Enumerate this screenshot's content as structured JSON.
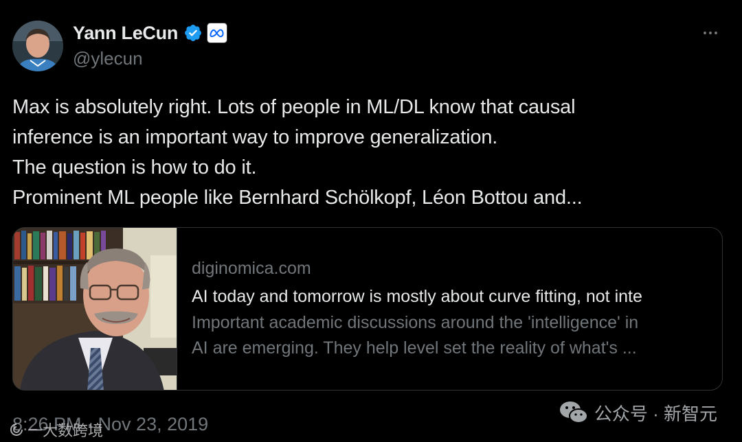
{
  "author": {
    "display_name": "Yann LeCun",
    "handle": "@ylecun",
    "verified_icon": "verified-badge-icon",
    "affiliation_icon": "meta-logo-icon",
    "avatar": "profile-photo"
  },
  "more_icon": "more-horizontal-icon",
  "tweet": {
    "lines": [
      "Max is absolutely right. Lots of people in ML/DL know that causal",
      "inference is an important way to improve generalization.",
      "The question is how to do it.",
      "Prominent ML people like Bernhard Schölkopf, Léon Bottou and..."
    ]
  },
  "card": {
    "domain": "diginomica.com",
    "title": "AI today and tomorrow is mostly about curve fitting, not inte",
    "description_lines": [
      "Important academic discussions around the 'intelligence' in",
      "AI are emerging. They help level set the reality of what's ..."
    ],
    "image": "photo-of-man-with-glasses-in-office"
  },
  "timestamp": "8:26 PM · Nov 23, 2019",
  "watermark": {
    "right_text": "公众号 · 新智元",
    "left_text": "一大数跨境",
    "right_icon": "wechat-icon"
  },
  "colors": {
    "background": "#000000",
    "text": "#e7e9ea",
    "secondary": "#71767b",
    "border": "#2f3336",
    "verified": "#1d9bf0"
  }
}
